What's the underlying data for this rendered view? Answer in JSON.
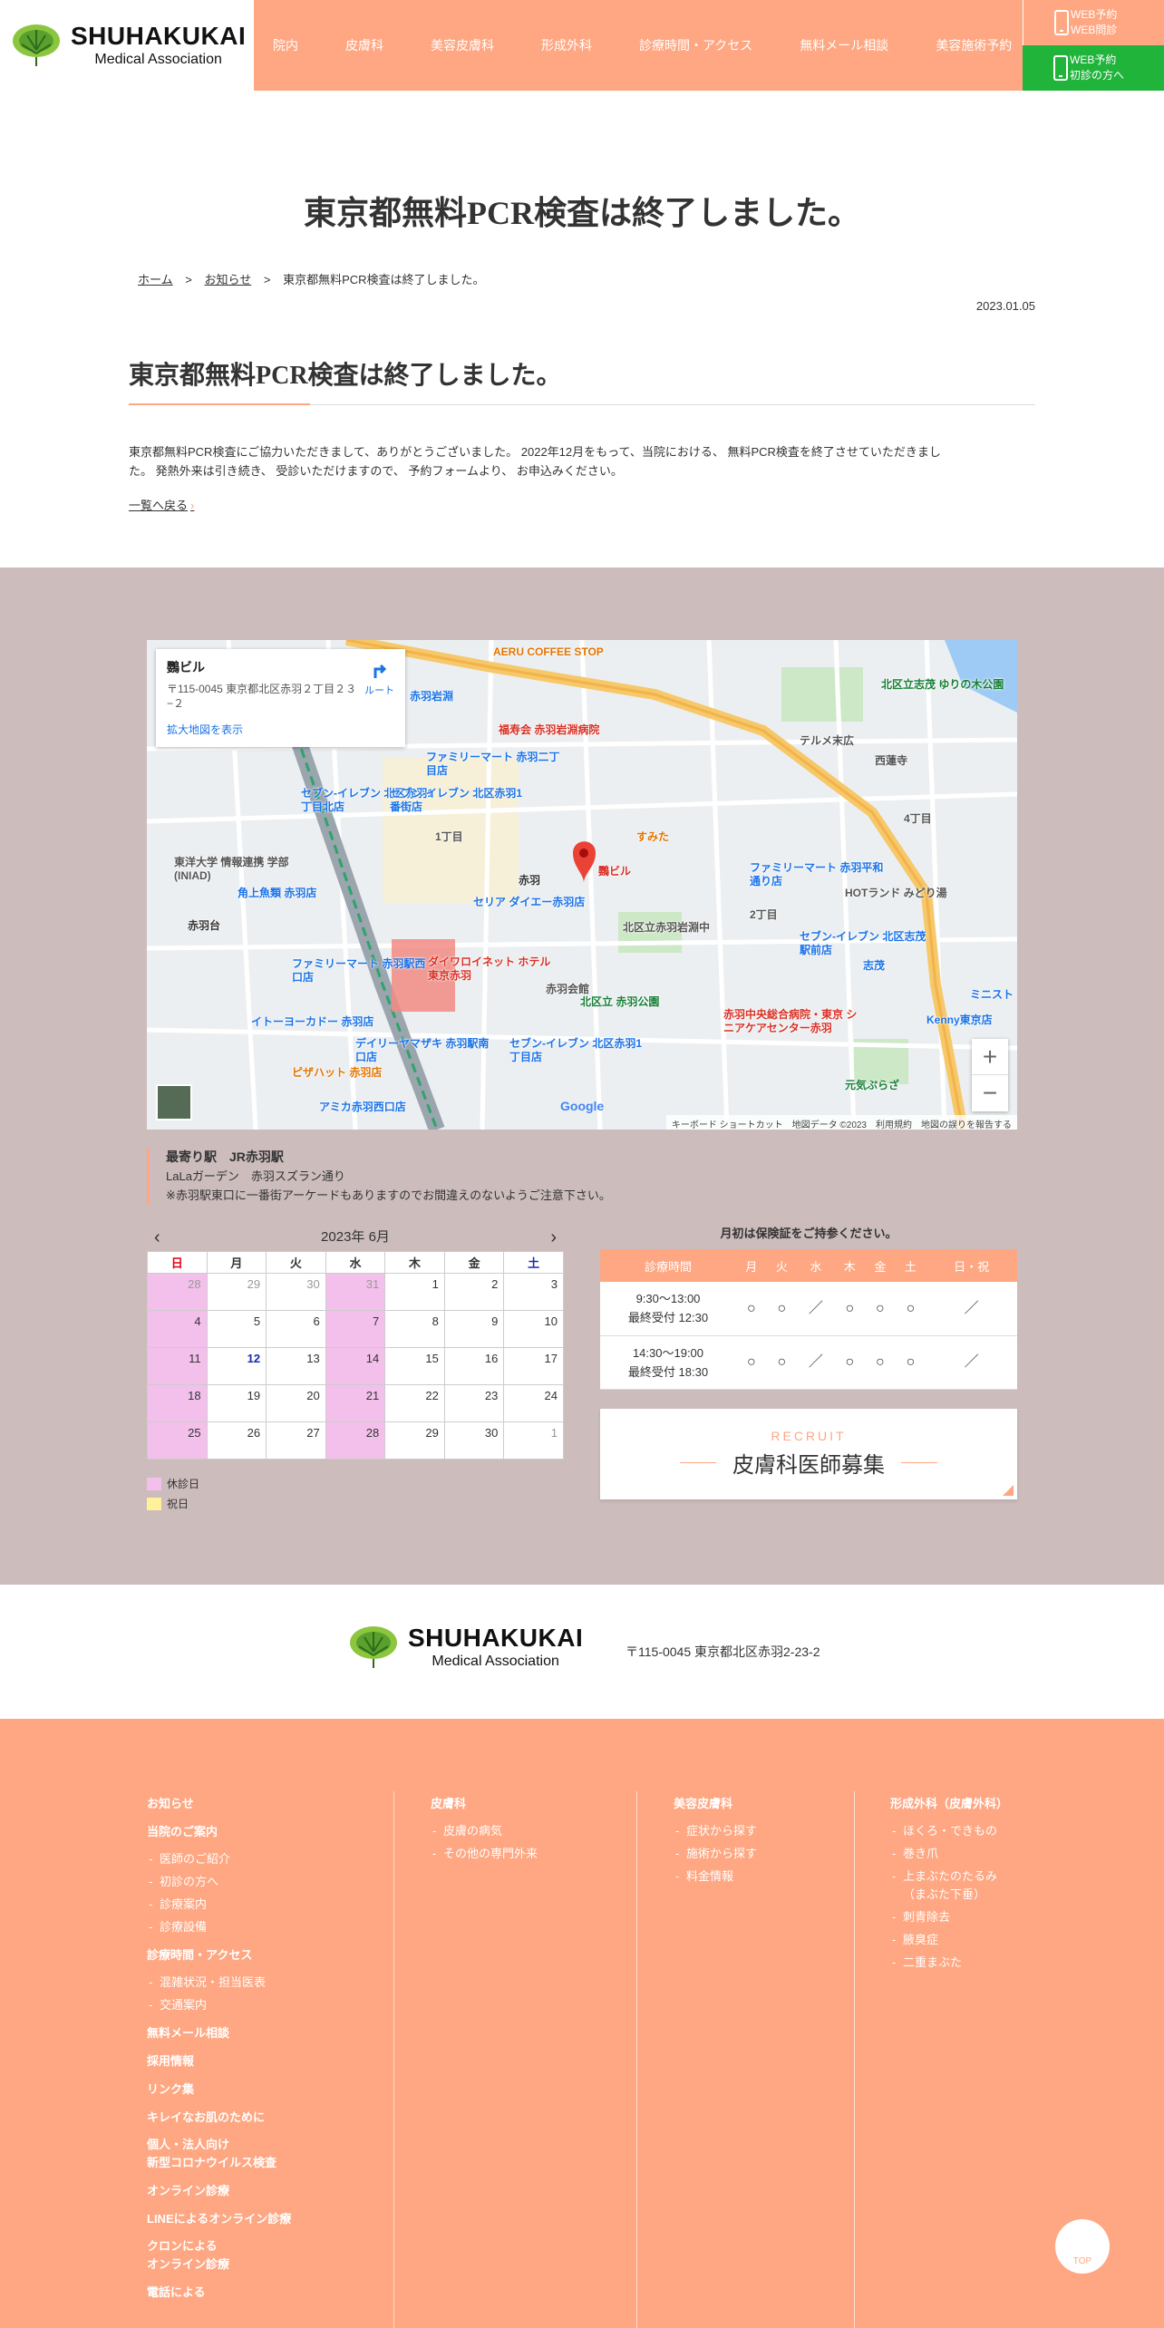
{
  "header": {
    "logo_main": "SHUHAKUKAI",
    "logo_sub": "Medical Association",
    "nav": [
      "院内",
      "皮膚科",
      "美容皮膚科",
      "形成外科",
      "診療時間・アクセス",
      "無料メール相談",
      "美容施術予約"
    ],
    "web_btn1_line1": "WEB予約",
    "web_btn1_line2": "WEB問診",
    "web_btn2_line1": "WEB予約",
    "web_btn2_line2": "初診の方へ"
  },
  "page": {
    "title": "東京都無料PCR検査は終了しました。",
    "breadcrumb": [
      "ホーム",
      "お知らせ",
      "東京都無料PCR検査は終了しました。"
    ],
    "breadcrumb_sep": ">",
    "date": "2023.01.05",
    "post_title": "東京都無料PCR検査は終了しました。",
    "body_line1": "東京都無料PCR検査にご協力いただきまして、ありがとうございました。 2022年12月をもって、当院における、 無料PCR検査を終了させていただきまし",
    "body_line2": "た。 発熱外来は引き続き、 受診いただけますので、 予約フォームより、 お申込みください。",
    "back_link": "一覧へ戻る",
    "back_chev": "›"
  },
  "map": {
    "place_name": "鸚ビル",
    "address": "〒115-0045 東京都北区赤羽２丁目２３−２",
    "route_label": "ルート",
    "enlarge_link": "拡大地図を表示",
    "footer": "キーボード ショートカット　地図データ ©2023　利用規約　地図の誤りを報告する",
    "google": "Google",
    "zoom_in": "+",
    "zoom_out": "−",
    "labels": [
      {
        "t": "AERU COFFEE STOP",
        "c": "#e37400"
      },
      {
        "t": "赤羽岩淵",
        "c": "#1a73e8"
      },
      {
        "t": "福寿会 赤羽岩淵病院",
        "c": "#d93025"
      },
      {
        "t": "北区立志茂 ゆりの木公園",
        "c": "#188038"
      },
      {
        "t": "テルメ末広",
        "c": "#555"
      },
      {
        "t": "西蓮寺",
        "c": "#555"
      },
      {
        "t": "ファミリーマート 赤羽二丁目店",
        "c": "#1a73e8"
      },
      {
        "t": "セブン-イレブン 北区赤羽1丁目北店",
        "c": "#1a73e8"
      },
      {
        "t": "セブン-イレブン 北区赤羽1番街店",
        "c": "#1a73e8"
      },
      {
        "t": "すみた",
        "c": "#e37400"
      },
      {
        "t": "鸚ビル",
        "c": "#d93025"
      },
      {
        "t": "ファミリーマート 赤羽平和通り店",
        "c": "#1a73e8"
      },
      {
        "t": "東洋大学 情報連携 学部(INIAD)",
        "c": "#555"
      },
      {
        "t": "角上魚類 赤羽店",
        "c": "#1a73e8"
      },
      {
        "t": "赤羽",
        "c": "#333"
      },
      {
        "t": "セリア ダイエー赤羽店",
        "c": "#1a73e8"
      },
      {
        "t": "HOTランド みどり湯",
        "c": "#555"
      },
      {
        "t": "北区立赤羽岩淵中",
        "c": "#555"
      },
      {
        "t": "セブン-イレブン 北区志茂駅前店",
        "c": "#1a73e8"
      },
      {
        "t": "志茂",
        "c": "#1a73e8"
      },
      {
        "t": "赤羽台",
        "c": "#333"
      },
      {
        "t": "ファミリーマート 赤羽駅西口店",
        "c": "#1a73e8"
      },
      {
        "t": "ダイワロイネット ホテル 東京赤羽",
        "c": "#d93025"
      },
      {
        "t": "赤羽会館",
        "c": "#555"
      },
      {
        "t": "北区立 赤羽公園",
        "c": "#188038"
      },
      {
        "t": "赤羽中央総合病院・東京 シニアケアセンター赤羽",
        "c": "#d93025"
      },
      {
        "t": "Kenny東京店",
        "c": "#1a73e8"
      },
      {
        "t": "ミニスト",
        "c": "#1a73e8"
      },
      {
        "t": "イトーヨーカドー 赤羽店",
        "c": "#1a73e8"
      },
      {
        "t": "デイリーヤマザキ 赤羽駅南口店",
        "c": "#1a73e8"
      },
      {
        "t": "セブン-イレブン 北区赤羽1丁目店",
        "c": "#1a73e8"
      },
      {
        "t": "ピザハット 赤羽店",
        "c": "#e37400"
      },
      {
        "t": "アミカ赤羽西口店",
        "c": "#1a73e8"
      },
      {
        "t": "元気ぷらざ",
        "c": "#188038"
      },
      {
        "t": "1丁目",
        "c": "#555"
      },
      {
        "t": "2丁目",
        "c": "#555"
      },
      {
        "t": "4丁目",
        "c": "#555"
      },
      {
        "t": "北区立志茂",
        "c": "#188038"
      }
    ]
  },
  "access": {
    "station_title": "最寄り駅　JR赤羽駅",
    "station_line2": "LaLaガーデン　赤羽スズラン通り",
    "station_line3": "※赤羽駅東口に一番街アーケードもありますのでお間違えのないようご注意下さい。"
  },
  "calendar": {
    "month_label": "2023年 6月",
    "prev": "‹",
    "next": "›",
    "weekdays": [
      "日",
      "月",
      "火",
      "水",
      "木",
      "金",
      "土"
    ],
    "weeks": [
      [
        {
          "d": "28",
          "o": true,
          "c": true
        },
        {
          "d": "29",
          "o": true
        },
        {
          "d": "30",
          "o": true
        },
        {
          "d": "31",
          "o": true,
          "c": true
        },
        {
          "d": "1"
        },
        {
          "d": "2"
        },
        {
          "d": "3"
        }
      ],
      [
        {
          "d": "4",
          "c": true
        },
        {
          "d": "5"
        },
        {
          "d": "6"
        },
        {
          "d": "7",
          "c": true
        },
        {
          "d": "8"
        },
        {
          "d": "9"
        },
        {
          "d": "10"
        }
      ],
      [
        {
          "d": "11",
          "c": true
        },
        {
          "d": "12",
          "t": true
        },
        {
          "d": "13"
        },
        {
          "d": "14",
          "c": true
        },
        {
          "d": "15"
        },
        {
          "d": "16"
        },
        {
          "d": "17"
        }
      ],
      [
        {
          "d": "18",
          "c": true
        },
        {
          "d": "19"
        },
        {
          "d": "20"
        },
        {
          "d": "21",
          "c": true
        },
        {
          "d": "22"
        },
        {
          "d": "23"
        },
        {
          "d": "24"
        }
      ],
      [
        {
          "d": "25",
          "c": true
        },
        {
          "d": "26"
        },
        {
          "d": "27"
        },
        {
          "d": "28",
          "c": true
        },
        {
          "d": "29"
        },
        {
          "d": "30"
        },
        {
          "d": "1",
          "o": true
        }
      ]
    ],
    "legend_closed": "休診日",
    "legend_holiday": "祝日",
    "closed_color": "#f3c0ec",
    "holiday_color": "#fff09a"
  },
  "hours": {
    "note": "月初は保険証をご持参ください。",
    "headers": [
      "診療時間",
      "月",
      "火",
      "水",
      "木",
      "金",
      "土",
      "日・祝"
    ],
    "rows": [
      {
        "time1": "9:30～13:00",
        "time2": "最終受付 12:30",
        "marks": [
          "○",
          "○",
          "／",
          "○",
          "○",
          "○",
          "／"
        ]
      },
      {
        "time1": "14:30〜19:00",
        "time2": "最終受付 18:30",
        "marks": [
          "○",
          "○",
          "／",
          "○",
          "○",
          "○",
          "／"
        ]
      }
    ]
  },
  "recruit": {
    "en": "RECRUIT",
    "ja": "皮膚科医師募集"
  },
  "footer": {
    "logo_main": "SHUHAKUKAI",
    "logo_sub": "Medical Association",
    "address": "〒115-0045 東京都北区赤羽2-23-2",
    "col1": [
      {
        "t": "お知らせ",
        "k": "b"
      },
      {
        "t": "当院のご案内",
        "k": "b"
      },
      {
        "t": "医師のご紹介",
        "k": "s"
      },
      {
        "t": "初診の方へ",
        "k": "s"
      },
      {
        "t": "診療案内",
        "k": "s"
      },
      {
        "t": "診療設備",
        "k": "s"
      },
      {
        "t": "診療時間・アクセス",
        "k": "b"
      },
      {
        "t": "混雑状況・担当医表",
        "k": "s"
      },
      {
        "t": "交通案内",
        "k": "s"
      },
      {
        "t": "無料メール相談",
        "k": "b"
      },
      {
        "t": "採用情報",
        "k": "b"
      },
      {
        "t": "リンク集",
        "k": "b"
      },
      {
        "t": "キレイなお肌のために",
        "k": "b"
      },
      {
        "t": "個人・法人向け\n新型コロナウイルス検査",
        "k": "bb"
      },
      {
        "t": "オンライン診療",
        "k": "b"
      },
      {
        "t": "LINEによるオンライン診療",
        "k": "b"
      },
      {
        "t": "クロンによる\nオンライン診療",
        "k": "bb"
      },
      {
        "t": "電話による",
        "k": "b"
      }
    ],
    "col2": [
      {
        "t": "皮膚科",
        "k": "b"
      },
      {
        "t": "皮膚の病気",
        "k": "s"
      },
      {
        "t": "その他の専門外来",
        "k": "s"
      }
    ],
    "col3": [
      {
        "t": "美容皮膚科",
        "k": "b"
      },
      {
        "t": "症状から探す",
        "k": "s"
      },
      {
        "t": "施術から探す",
        "k": "s"
      },
      {
        "t": "料金情報",
        "k": "s"
      }
    ],
    "col4": [
      {
        "t": "形成外科（皮膚外科）",
        "k": "b"
      },
      {
        "t": "ほくろ・できもの",
        "k": "s"
      },
      {
        "t": "巻き爪",
        "k": "s"
      },
      {
        "t": "上まぶたのたるみ\n（まぶた下垂）",
        "k": "s"
      },
      {
        "t": "刺青除去",
        "k": "s"
      },
      {
        "t": "腋臭症",
        "k": "s"
      },
      {
        "t": "二重まぶた",
        "k": "s"
      }
    ],
    "top_label": "TOP"
  }
}
